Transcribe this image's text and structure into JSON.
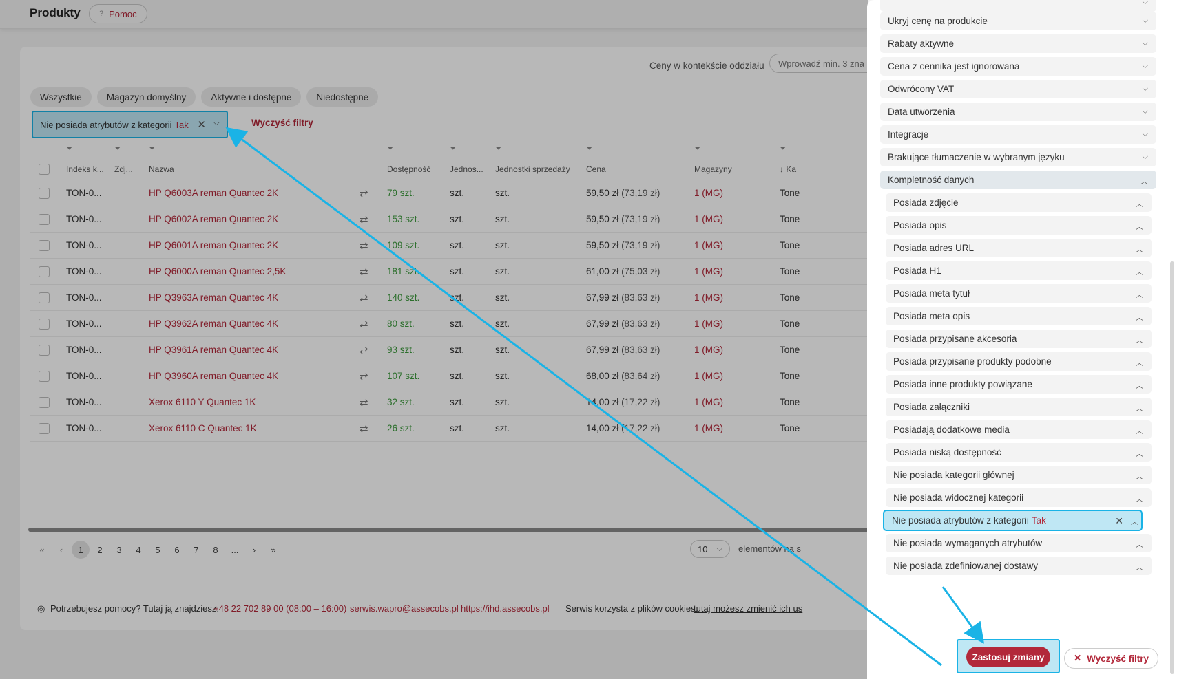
{
  "header": {
    "title": "Produkty",
    "help_label": "Pomoc",
    "help_icon": "?"
  },
  "context": {
    "label": "Ceny w kontekście oddziału",
    "placeholder": "Wprowadź min. 3 zna"
  },
  "tabs": [
    "Wszystkie",
    "Magazyn domyślny",
    "Aktywne i dostępne",
    "Niedostępne"
  ],
  "active_filter": {
    "label": "Nie posiada atrybutów z kategorii",
    "value": "Tak"
  },
  "clear_filters_link": "Wyczyść filtry",
  "table": {
    "columns": [
      "Indeks k...",
      "Zdj...",
      "Nazwa",
      "Dostępność",
      "Jednos...",
      "Jednostki sprzedaży",
      "Cena",
      "Magazyny",
      "↓ Ka"
    ],
    "rows": [
      {
        "index": "TON-0...",
        "name": "HP Q6003A reman Quantec 2K",
        "stock": "79 szt.",
        "unit": "szt.",
        "sale_unit": "szt.",
        "price": "59,50 zł",
        "price_gross": "(73,19 zł)",
        "warehouses": "1 (MG)",
        "category": "Tone"
      },
      {
        "index": "TON-0...",
        "name": "HP Q6002A reman Quantec 2K",
        "stock": "153 szt.",
        "unit": "szt.",
        "sale_unit": "szt.",
        "price": "59,50 zł",
        "price_gross": "(73,19 zł)",
        "warehouses": "1 (MG)",
        "category": "Tone"
      },
      {
        "index": "TON-0...",
        "name": "HP Q6001A reman Quantec 2K",
        "stock": "109 szt.",
        "unit": "szt.",
        "sale_unit": "szt.",
        "price": "59,50 zł",
        "price_gross": "(73,19 zł)",
        "warehouses": "1 (MG)",
        "category": "Tone"
      },
      {
        "index": "TON-0...",
        "name": "HP Q6000A reman Quantec 2,5K",
        "stock": "181 szt.",
        "unit": "szt.",
        "sale_unit": "szt.",
        "price": "61,00 zł",
        "price_gross": "(75,03 zł)",
        "warehouses": "1 (MG)",
        "category": "Tone"
      },
      {
        "index": "TON-0...",
        "name": "HP Q3963A reman Quantec 4K",
        "stock": "140 szt.",
        "unit": "szt.",
        "sale_unit": "szt.",
        "price": "67,99 zł",
        "price_gross": "(83,63 zł)",
        "warehouses": "1 (MG)",
        "category": "Tone"
      },
      {
        "index": "TON-0...",
        "name": "HP Q3962A reman Quantec 4K",
        "stock": "80 szt.",
        "unit": "szt.",
        "sale_unit": "szt.",
        "price": "67,99 zł",
        "price_gross": "(83,63 zł)",
        "warehouses": "1 (MG)",
        "category": "Tone"
      },
      {
        "index": "TON-0...",
        "name": "HP Q3961A reman Quantec 4K",
        "stock": "93 szt.",
        "unit": "szt.",
        "sale_unit": "szt.",
        "price": "67,99 zł",
        "price_gross": "(83,63 zł)",
        "warehouses": "1 (MG)",
        "category": "Tone"
      },
      {
        "index": "TON-0...",
        "name": "HP Q3960A reman Quantec 4K",
        "stock": "107 szt.",
        "unit": "szt.",
        "sale_unit": "szt.",
        "price": "68,00 zł",
        "price_gross": "(83,64 zł)",
        "warehouses": "1 (MG)",
        "category": "Tone"
      },
      {
        "index": "TON-0...",
        "name": "Xerox 6110 Y Quantec 1K",
        "stock": "32 szt.",
        "unit": "szt.",
        "sale_unit": "szt.",
        "price": "14,00 zł",
        "price_gross": "(17,22 zł)",
        "warehouses": "1 (MG)",
        "category": "Tone"
      },
      {
        "index": "TON-0...",
        "name": "Xerox 6110 C Quantec 1K",
        "stock": "26 szt.",
        "unit": "szt.",
        "sale_unit": "szt.",
        "price": "14,00 zł",
        "price_gross": "(17,22 zł)",
        "warehouses": "1 (MG)",
        "category": "Tone"
      }
    ]
  },
  "pagination": {
    "first": "«",
    "prev": "‹",
    "pages": [
      "1",
      "2",
      "3",
      "4",
      "5",
      "6",
      "7",
      "8",
      "..."
    ],
    "next": "›",
    "last": "»",
    "per_page": "10",
    "per_page_label": "elementów na s"
  },
  "footer": {
    "help_text": "Potrzebujesz pomocy? Tutaj ją znajdziesz:",
    "phone": "+48 22 702 89 00 (08:00 – 16:00)",
    "email": "serwis.wapro@assecobs.pl",
    "url": "https://ihd.assecobs.pl",
    "cookies_text": "Serwis korzysta z plików cookies,",
    "cookies_link": "tutaj możesz zmienić ich us"
  },
  "drawer": {
    "filters": [
      "Ukryj cenę na produkcie",
      "Rabaty aktywne",
      "Cena z cennika jest ignorowana",
      "Odwrócony VAT",
      "Data utworzenia",
      "Integracje",
      "Brakujące tłumaczenie w wybranym języku"
    ],
    "open_group": "Kompletność danych",
    "sub_filters": [
      "Posiada zdjęcie",
      "Posiada opis",
      "Posiada adres URL",
      "Posiada H1",
      "Posiada meta tytuł",
      "Posiada meta opis",
      "Posiada przypisane akcesoria",
      "Posiada przypisane produkty podobne",
      "Posiada inne produkty powiązane",
      "Posiada załączniki",
      "Posiadają dodatkowe media",
      "Posiada niską dostępność",
      "Nie posiada kategorii głównej",
      "Nie posiada widocznej kategorii"
    ],
    "selected_sub": {
      "label": "Nie posiada atrybutów z kategorii",
      "value": "Tak"
    },
    "sub_filters_after": [
      "Nie posiada wymaganych atrybutów",
      "Nie posiada zdefiniowanej dostawy"
    ],
    "apply_label": "Zastosuj zmiany",
    "clear_label": "Wyczyść filtry"
  },
  "colors": {
    "accent": "#b2283a",
    "highlight": "#1ab3e6",
    "stock_green": "#3d9a3d"
  }
}
